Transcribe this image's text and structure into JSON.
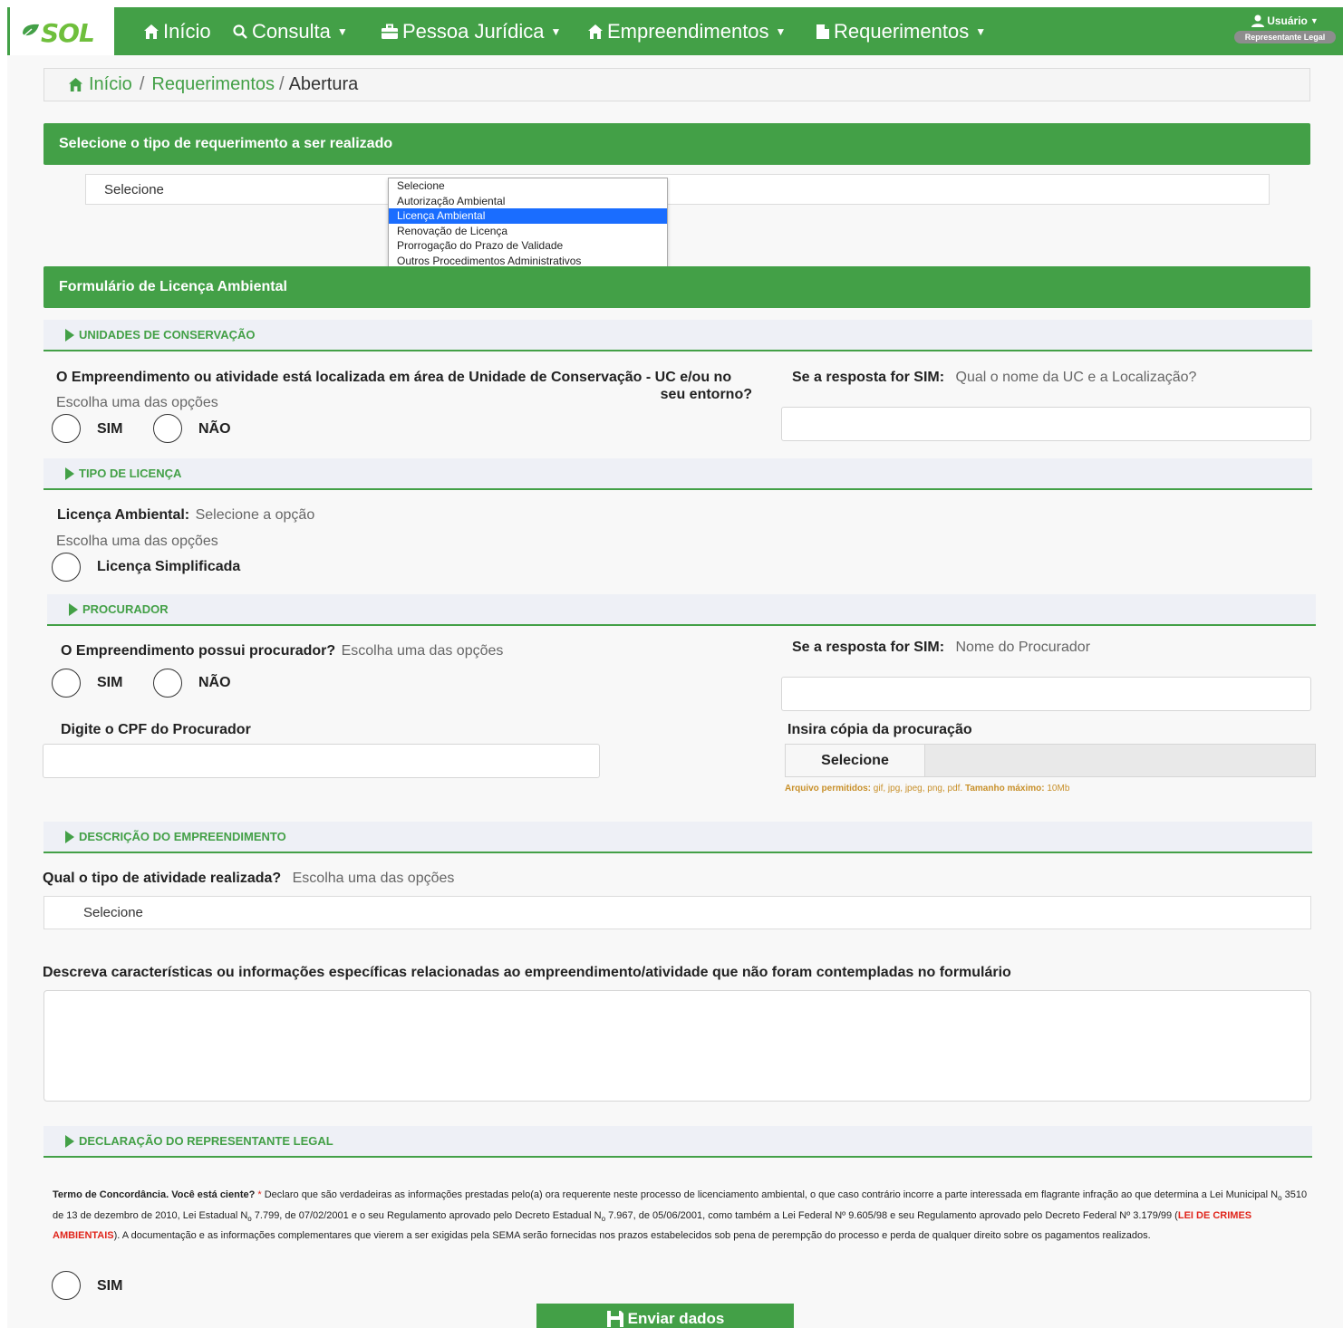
{
  "app": {
    "logo_text": "SOL",
    "accent_color": "#43a047"
  },
  "nav": {
    "items": [
      {
        "label": "Início",
        "icon": "home-icon"
      },
      {
        "label": "Consulta",
        "icon": "search-icon"
      },
      {
        "label": "Pessoa Jurídica",
        "icon": "briefcase-icon"
      },
      {
        "label": "Empreendimentos",
        "icon": "home-icon"
      },
      {
        "label": "Requerimentos",
        "icon": "document-icon"
      }
    ],
    "user_label": "Usuário",
    "user_role": "Representante Legal"
  },
  "breadcrumb": {
    "items": [
      "Início",
      "Requerimentos"
    ],
    "current": "Abertura"
  },
  "type_select": {
    "header": "Selecione o tipo de requerimento a ser realizado",
    "value": "Selecione",
    "options": [
      "Selecione",
      "Autorização Ambiental",
      "Licença Ambiental",
      "Renovação de Licença",
      "Prorrogação do Prazo de Validade",
      "Outros Procedimentos Administrativos"
    ],
    "highlighted": "Licença Ambiental"
  },
  "form": {
    "header": "Formulário de Licença Ambiental",
    "sections": {
      "uc": "UNIDADES DE CONSERVAÇÃO",
      "tipo": "TIPO DE LICENÇA",
      "procurador": "PROCURADOR",
      "descricao": "DESCRIÇÃO DO EMPREENDIMENTO",
      "declaracao": "DECLARAÇÃO DO REPRESENTANTE LEGAL"
    },
    "uc": {
      "question_line1": "O Empreendimento ou atividade está localizada em área de Unidade de Conservação - UC e/ou no",
      "question_line2": "seu entorno?",
      "choose_hint": "Escolha uma das opções",
      "yes": "SIM",
      "no": "NÃO",
      "if_yes_label": "Se a resposta for SIM:",
      "if_yes_hint": "Qual o nome da UC e a Localização?"
    },
    "tipo": {
      "label": "Licença Ambiental:",
      "label_hint": "Selecione a opção",
      "choose_hint": "Escolha uma das opções",
      "option": "Licença Simplificada"
    },
    "procurador": {
      "question": "O Empreendimento possui procurador?",
      "question_hint": "Escolha uma das opções",
      "yes": "SIM",
      "no": "NÃO",
      "if_yes_label": "Se a resposta for SIM:",
      "if_yes_hint": "Nome do Procurador",
      "cpf_label": "Digite o CPF do Procurador",
      "upload_label": "Insira cópia da procuração",
      "upload_button": "Selecione",
      "upload_note_label": "Arquivo permitidos:",
      "upload_note_types": "gif, jpg, jpeg, png, pdf.",
      "upload_note_size_label": "Tamanho máximo:",
      "upload_note_size": "10Mb"
    },
    "descricao": {
      "activity_label": "Qual o tipo de atividade realizada?",
      "activity_hint": "Escolha uma das opções",
      "activity_value": "Selecione",
      "details_label": "Descreva características ou informações específicas relacionadas ao empreendimento/atividade que não foram contempladas no formulário"
    },
    "declaracao": {
      "terms_title": "Termo de Concordância. Você está ciente?",
      "required_mark": "*",
      "terms_text_1": " Declaro que são verdadeiras as informações prestadas pelo(a) ora requerente neste processo de licenciamento ambiental, o que caso contrário incorre a parte interessada em flagrante infração ao que determina a Lei Municipal N",
      "terms_text_1b": "3510 de 13 de dezembro de 2010, Lei Estadual N",
      "terms_text_1c": "7.799, de 07/02/2001 e o seu Regulamento aprovado pelo Decreto Estadual N",
      "terms_text_1d": "7.967, de 05/06/2001, como também a Lei Federal Nº 9.605/98 e seu Regulamento aprovado pelo Decreto Federal Nº 3.179/99 (",
      "num_mark": "o",
      "law_name": "LEI DE CRIMES AMBIENTAIS",
      "terms_text_2": "). A documentação e as informações complementares que vierem a ser exigidas pela SEMA serão fornecidas nos prazos estabelecidos sob pena de perempção do processo e perda de qualquer direito sobre os pagamentos realizados.",
      "yes": "SIM"
    },
    "submit_label": "Enviar dados"
  }
}
